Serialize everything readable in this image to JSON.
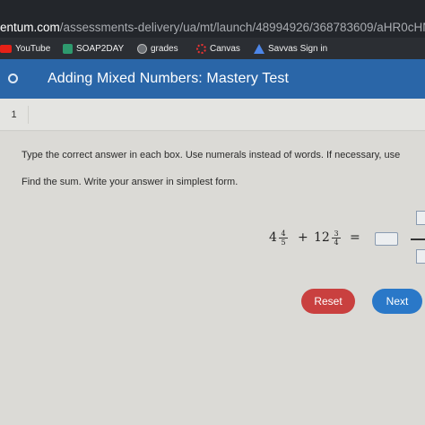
{
  "browser": {
    "url_domain": "entum.com",
    "url_path": "/assessments-delivery/ua/mt/launch/48994926/368783609/aHR0cHM6Ly9mb",
    "bookmarks": [
      {
        "label": "YouTube",
        "icon": "youtube-icon"
      },
      {
        "label": "SOAP2DAY",
        "icon": "soap2day-icon"
      },
      {
        "label": "grades",
        "icon": "grades-icon"
      },
      {
        "label": "Canvas",
        "icon": "canvas-icon"
      },
      {
        "label": "Savvas Sign in",
        "icon": "savvas-icon"
      }
    ]
  },
  "test": {
    "title": "Adding Mixed Numbers: Mastery Test"
  },
  "question": {
    "number": "1",
    "instructions": "Type the correct answer in each box. Use numerals instead of words. If necessary, use",
    "prompt": "Find the sum. Write your answer in simplest form.",
    "term1": {
      "whole": "4",
      "num": "4",
      "den": "5"
    },
    "operator": "+",
    "term2": {
      "whole": "12",
      "num": "3",
      "den": "4"
    },
    "equals": "=",
    "answer": {
      "whole": "",
      "num": "",
      "den": ""
    }
  },
  "actions": {
    "reset_label": "Reset",
    "next_label": "Next"
  },
  "colors": {
    "header_blue": "#2a66a8",
    "reset_red": "#c9403f",
    "next_blue": "#2a78c8"
  }
}
